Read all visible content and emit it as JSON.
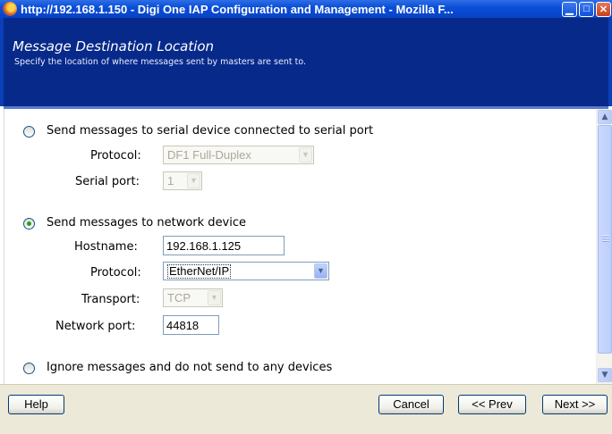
{
  "window": {
    "title": "http://192.168.1.150 - Digi One IAP Configuration and Management - Mozilla F...",
    "controls": [
      "minimize-icon",
      "maximize-icon",
      "close-icon"
    ]
  },
  "header": {
    "title": "Message Destination Location",
    "subtitle": "Specify the location of where messages sent by masters are sent to."
  },
  "options": {
    "serial": {
      "label": "Send messages to serial device connected to serial port",
      "selected": false,
      "protocol_label": "Protocol:",
      "protocol_value": "DF1 Full-Duplex",
      "serial_port_label": "Serial port:",
      "serial_port_value": "1"
    },
    "network": {
      "label": "Send messages to network device",
      "selected": true,
      "hostname_label": "Hostname:",
      "hostname_value": "192.168.1.125",
      "protocol_label": "Protocol:",
      "protocol_value": "EtherNet/IP",
      "transport_label": "Transport:",
      "transport_value": "TCP",
      "network_port_label": "Network port:",
      "network_port_value": "44818"
    },
    "ignore": {
      "label": "Ignore messages and do not send to any devices",
      "selected": false
    }
  },
  "buttons": {
    "help": "Help",
    "cancel": "Cancel",
    "prev": "<< Prev",
    "next": "Next >>"
  },
  "icons": {
    "app": "firefox-icon",
    "scroll_up": "scroll-up-arrow-icon",
    "scroll_down": "scroll-down-arrow-icon",
    "dropdown": "chevron-down-icon"
  }
}
